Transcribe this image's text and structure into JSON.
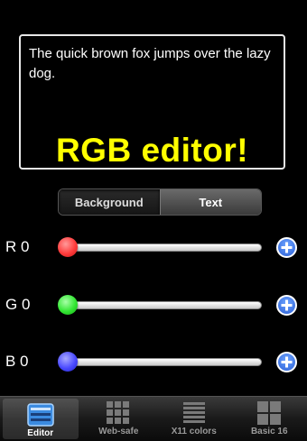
{
  "preview": {
    "sample_text": "The quick brown fox jumps over the lazy dog.",
    "title": "RGB editor!",
    "text_color": "#ffff00",
    "background_color": "#000000"
  },
  "segmented": {
    "background_label": "Background",
    "text_label": "Text",
    "selected": "Background"
  },
  "sliders": [
    {
      "label": "R 0",
      "value": 0,
      "max": 255,
      "thumb_color": "#ff3b3b"
    },
    {
      "label": "G 0",
      "value": 0,
      "max": 255,
      "thumb_color": "#33e633"
    },
    {
      "label": "B 0",
      "value": 0,
      "max": 255,
      "thumb_color": "#4a4aff"
    }
  ],
  "tabs": [
    {
      "label": "Editor",
      "icon": "editor-icon",
      "active": true
    },
    {
      "label": "Web-safe",
      "icon": "grid-icon",
      "active": false
    },
    {
      "label": "X11 colors",
      "icon": "list-icon",
      "active": false
    },
    {
      "label": "Basic 16",
      "icon": "grid-icon",
      "active": false
    }
  ]
}
